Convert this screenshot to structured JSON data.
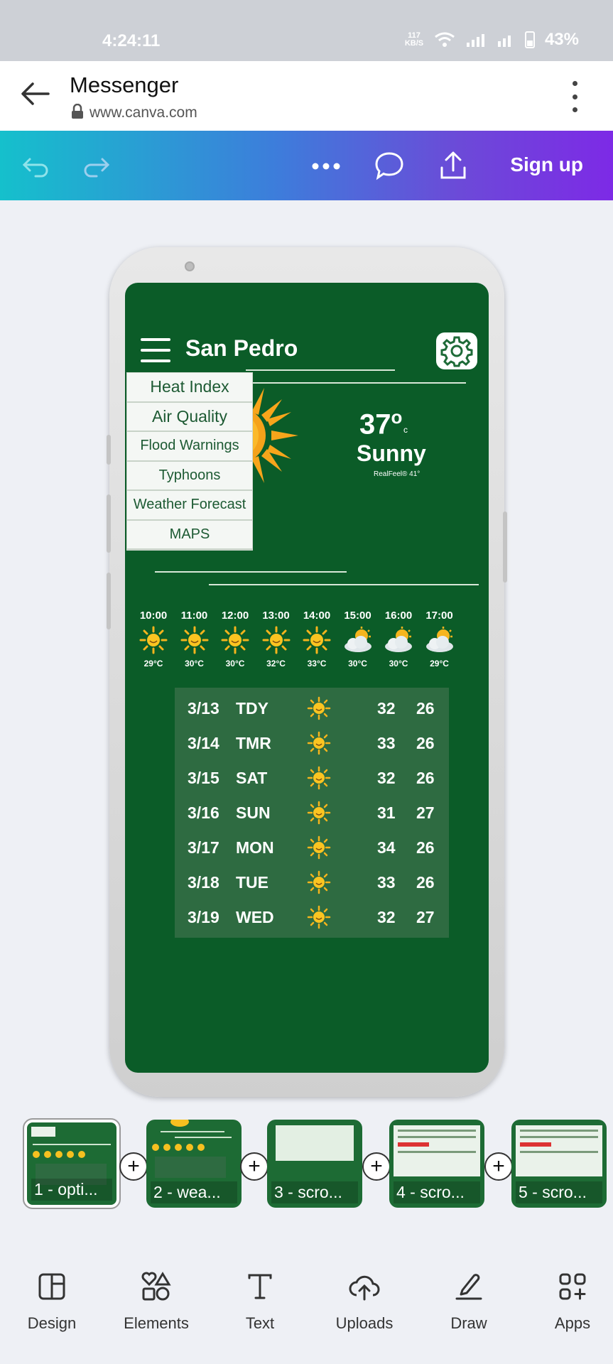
{
  "status_bar": {
    "time": "4:24:11",
    "speed": "117 KB/S",
    "battery": "43%"
  },
  "browser": {
    "title": "Messenger",
    "url": "www.canva.com"
  },
  "canva_toolbar": {
    "signup_label": "Sign up",
    "icons": [
      "undo-icon",
      "redo-icon",
      "more-icon",
      "comment-icon",
      "share-icon"
    ]
  },
  "phone_screen": {
    "city": "San Pedro",
    "menu": [
      "Heat Index",
      "Air Quality",
      "Flood Warnings",
      "Typhoons",
      "Weather Forecast",
      "MAPS"
    ],
    "temperature": "37",
    "degree": "o",
    "unit": "c",
    "condition": "Sunny",
    "realfeel": "RealFeel® 41°",
    "hourly": [
      {
        "time": "10:00",
        "icon": "sun-icon",
        "temp": "29°C"
      },
      {
        "time": "11:00",
        "icon": "sun-icon",
        "temp": "30°C"
      },
      {
        "time": "12:00",
        "icon": "sun-icon",
        "temp": "30°C"
      },
      {
        "time": "13:00",
        "icon": "sun-icon",
        "temp": "32°C"
      },
      {
        "time": "14:00",
        "icon": "sun-icon",
        "temp": "33°C"
      },
      {
        "time": "15:00",
        "icon": "partly-cloudy-icon",
        "temp": "30°C"
      },
      {
        "time": "16:00",
        "icon": "partly-cloudy-icon",
        "temp": "30°C"
      },
      {
        "time": "17:00",
        "icon": "partly-cloudy-icon",
        "temp": "29°C"
      }
    ],
    "daily": [
      {
        "date": "3/13",
        "day": "TDY",
        "high": "32",
        "low": "26"
      },
      {
        "date": "3/14",
        "day": "TMR",
        "high": "33",
        "low": "26"
      },
      {
        "date": "3/15",
        "day": "SAT",
        "high": "32",
        "low": "26"
      },
      {
        "date": "3/16",
        "day": "SUN",
        "high": "31",
        "low": "27"
      },
      {
        "date": "3/17",
        "day": "MON",
        "high": "34",
        "low": "26"
      },
      {
        "date": "3/18",
        "day": "TUE",
        "high": "33",
        "low": "26"
      },
      {
        "date": "3/19",
        "day": "WED",
        "high": "32",
        "low": "27"
      }
    ]
  },
  "pages": [
    {
      "label": "1 - opti...",
      "active": true
    },
    {
      "label": "2 - wea...",
      "active": false
    },
    {
      "label": "3 - scro...",
      "active": false
    },
    {
      "label": "4 - scro...",
      "active": false
    },
    {
      "label": "5 - scro...",
      "active": false
    }
  ],
  "add_page_label": "+",
  "bottom_tools": [
    {
      "label": "Design",
      "icon": "design-icon"
    },
    {
      "label": "Elements",
      "icon": "elements-icon"
    },
    {
      "label": "Text",
      "icon": "text-icon"
    },
    {
      "label": "Uploads",
      "icon": "uploads-icon"
    },
    {
      "label": "Draw",
      "icon": "draw-icon"
    },
    {
      "label": "Apps",
      "icon": "apps-icon"
    }
  ]
}
